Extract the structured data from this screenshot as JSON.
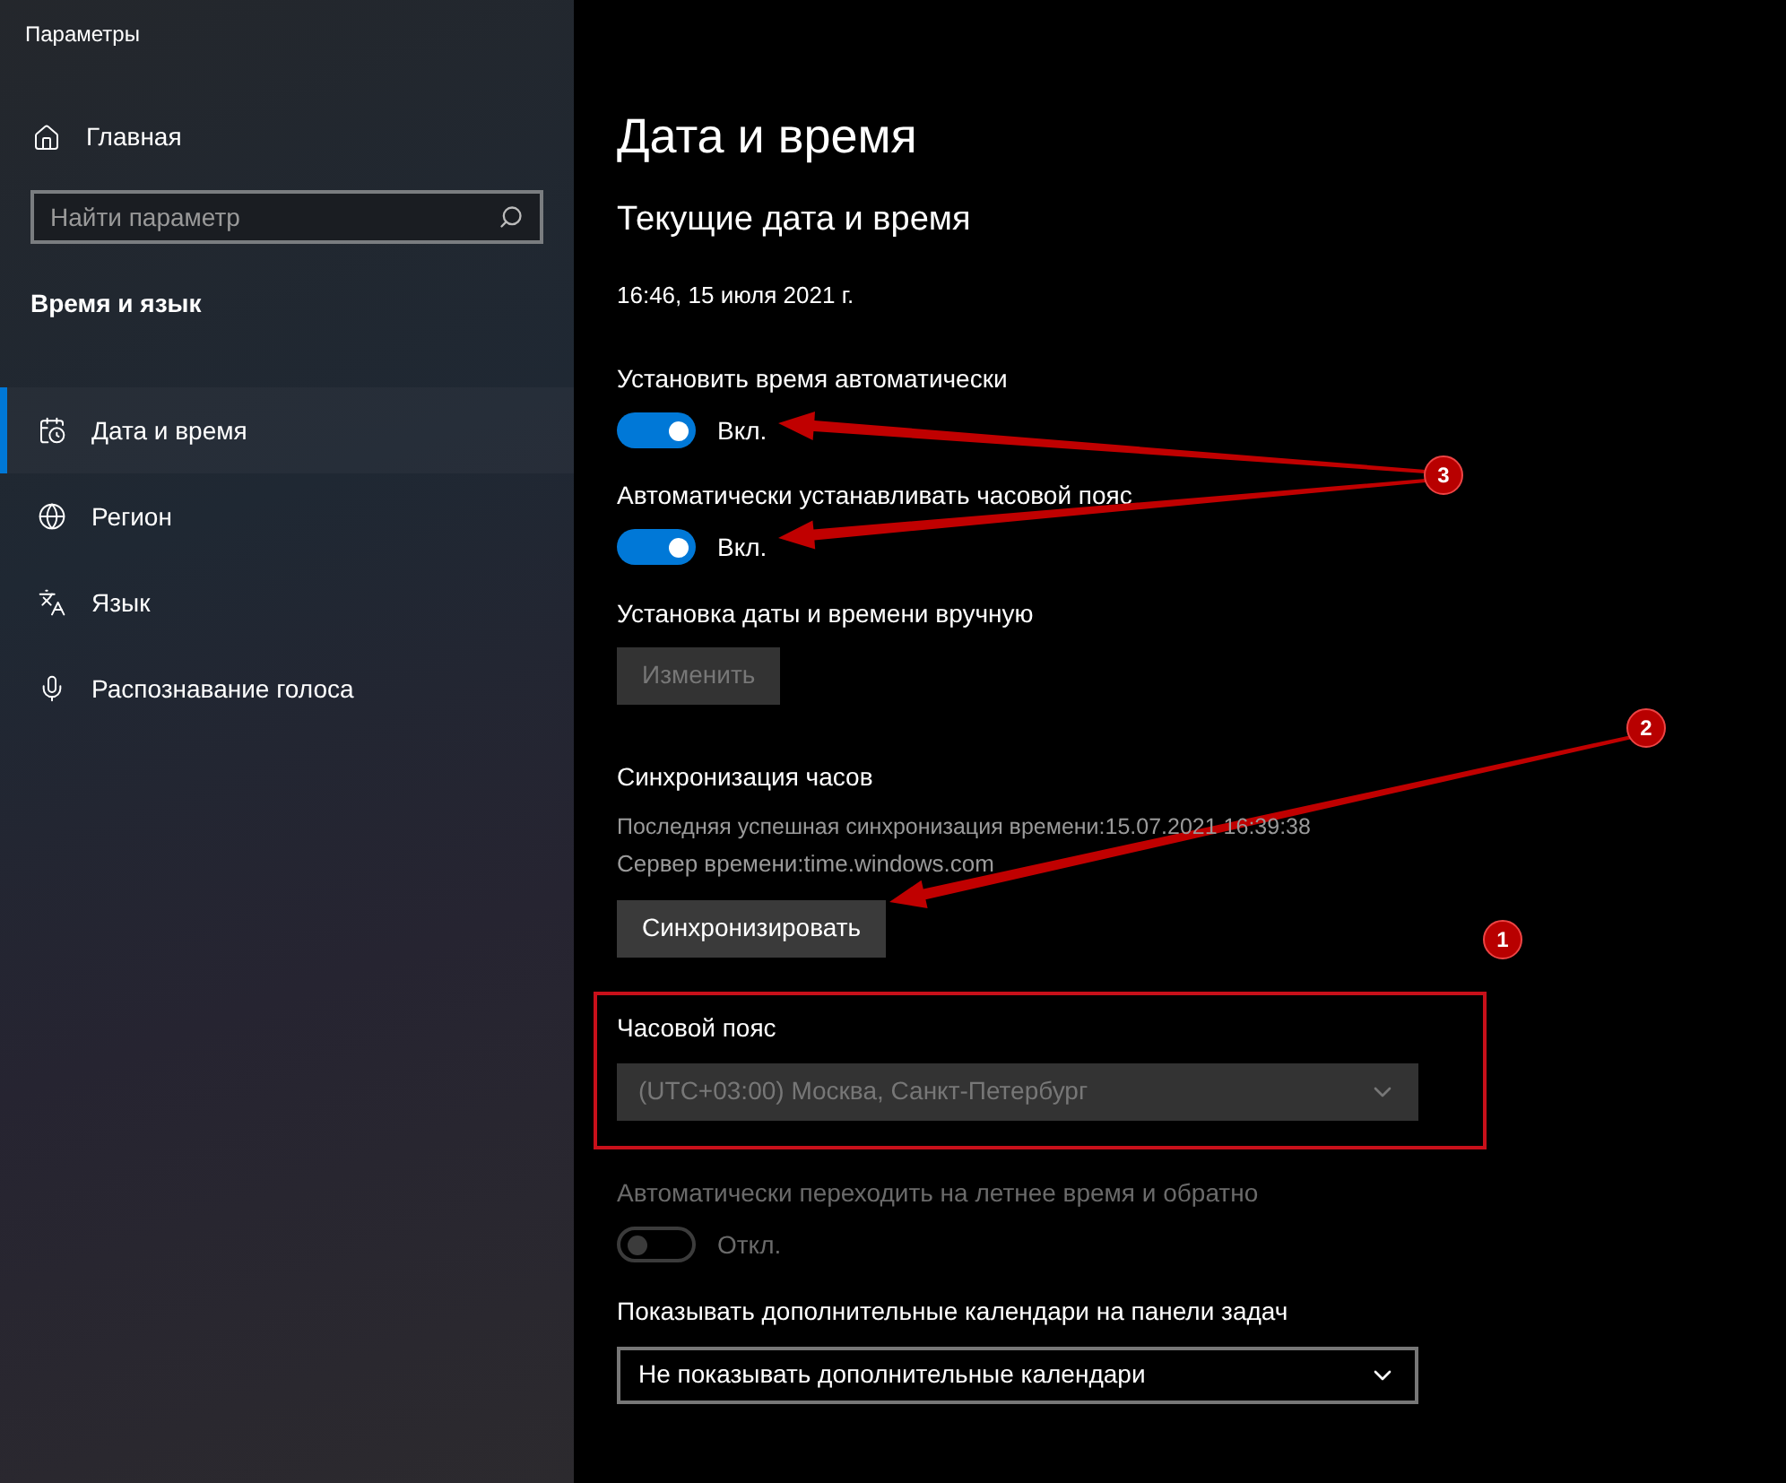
{
  "window": {
    "title": "Параметры"
  },
  "sidebar": {
    "home": {
      "label": "Главная"
    },
    "search": {
      "placeholder": "Найти параметр"
    },
    "section": "Время и язык",
    "items": [
      {
        "label": "Дата и время",
        "selected": true
      },
      {
        "label": "Регион",
        "selected": false
      },
      {
        "label": "Язык",
        "selected": false
      },
      {
        "label": "Распознавание голоса",
        "selected": false
      }
    ]
  },
  "page": {
    "title": "Дата и время",
    "subtitle": "Текущие дата и время",
    "current": "16:46, 15 июля 2021 г.",
    "auto_time": {
      "label": "Установить время автоматически",
      "on": true,
      "state": "Вкл."
    },
    "auto_zone": {
      "label": "Автоматически устанавливать часовой пояс",
      "on": true,
      "state": "Вкл."
    },
    "manual": {
      "label": "Установка даты и времени вручную",
      "button": "Изменить",
      "disabled": true
    },
    "sync": {
      "heading": "Синхронизация часов",
      "last": "Последняя успешная синхронизация времени:15.07.2021 16:39:38",
      "server": "Сервер времени:time.windows.com",
      "button": "Синхронизировать"
    },
    "timezone": {
      "label": "Часовой пояс",
      "value": "(UTC+03:00) Москва, Санкт-Петербург",
      "disabled": true,
      "highlighted": true
    },
    "dst": {
      "label": "Автоматически переходить на летнее время и обратно",
      "on": false,
      "state": "Откл.",
      "disabled": true
    },
    "calendars": {
      "label": "Показывать дополнительные календари на панели задач",
      "value": "Не показывать дополнительные календари"
    }
  },
  "annotations": [
    {
      "number": "3"
    },
    {
      "number": "2"
    },
    {
      "number": "1"
    }
  ]
}
